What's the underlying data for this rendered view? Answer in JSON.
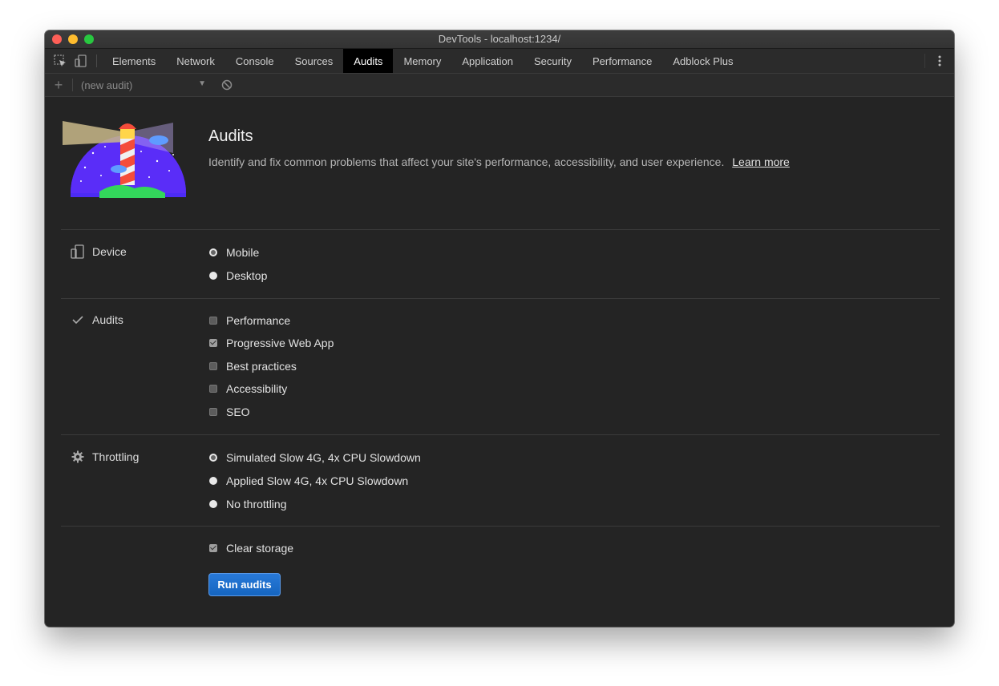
{
  "window": {
    "title": "DevTools - localhost:1234/"
  },
  "toolbar": {
    "tabs": [
      "Elements",
      "Network",
      "Console",
      "Sources",
      "Audits",
      "Memory",
      "Application",
      "Security",
      "Performance",
      "Adblock Plus"
    ],
    "active_tab": "Audits"
  },
  "subbar": {
    "audit_select": "(new audit)"
  },
  "hero": {
    "title": "Audits",
    "description": "Identify and fix common problems that affect your site's performance, accessibility, and user experience.",
    "learn_more": "Learn more"
  },
  "device": {
    "label": "Device",
    "options": [
      {
        "label": "Mobile",
        "selected": true
      },
      {
        "label": "Desktop",
        "selected": false
      }
    ]
  },
  "audits": {
    "label": "Audits",
    "options": [
      {
        "label": "Performance",
        "checked": false
      },
      {
        "label": "Progressive Web App",
        "checked": true
      },
      {
        "label": "Best practices",
        "checked": false
      },
      {
        "label": "Accessibility",
        "checked": false
      },
      {
        "label": "SEO",
        "checked": false
      }
    ]
  },
  "throttling": {
    "label": "Throttling",
    "options": [
      {
        "label": "Simulated Slow 4G, 4x CPU Slowdown",
        "selected": true
      },
      {
        "label": "Applied Slow 4G, 4x CPU Slowdown",
        "selected": false
      },
      {
        "label": "No throttling",
        "selected": false
      }
    ]
  },
  "clear_storage": {
    "label": "Clear storage",
    "checked": true
  },
  "run_button": "Run audits",
  "colors": {
    "accent": "#1a73e8",
    "background": "#242424"
  }
}
